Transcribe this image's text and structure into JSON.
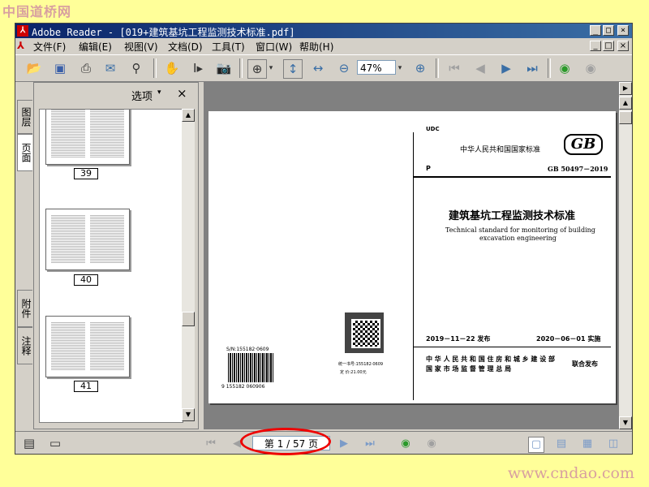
{
  "watermarks": {
    "top": "中国道桥网",
    "bottom": "www.cndao.com"
  },
  "window": {
    "title": "Adobe Reader - [019+建筑基坑工程监测技术标准.pdf]",
    "app_icon": "adobe-reader-icon",
    "controls": [
      "_",
      "□",
      "×"
    ]
  },
  "menu": {
    "items": [
      "文件(F)",
      "编辑(E)",
      "视图(V)",
      "文档(D)",
      "工具(T)",
      "窗口(W)",
      "帮助(H)"
    ],
    "doc_controls": [
      "_",
      "□",
      "×"
    ]
  },
  "toolbar": {
    "zoom_value": "47%",
    "icons": [
      "open-icon",
      "save-icon",
      "print-icon",
      "email-icon",
      "search-icon",
      "hand-icon",
      "select-text-icon",
      "snapshot-icon",
      "zoom-in-tool-icon",
      "fit-page-icon",
      "fit-width-icon",
      "zoom-out-icon",
      "zoom-in-icon",
      "first-page-icon",
      "prev-page-icon",
      "next-page-icon",
      "last-page-icon",
      "back-icon",
      "forward-icon"
    ]
  },
  "side_tabs": [
    "图层",
    "页面",
    "附件",
    "注释"
  ],
  "nav_panel": {
    "options_label": "选项",
    "close_label": "×",
    "thumbnails": [
      {
        "label": "39"
      },
      {
        "label": "40"
      },
      {
        "label": "41"
      }
    ]
  },
  "document_page": {
    "udc": "UDC",
    "national_standard": "中华人民共和国国家标准",
    "gb_logo": "GB",
    "category": "P",
    "code": "GB 50497－2019",
    "title_cn": "建筑基坑工程监测技术标准",
    "title_en_line1": "Technical standard for monitoring of building",
    "title_en_line2": "excavation engineering",
    "publish_date": "2019－11－22 发布",
    "implement_date": "2020－06－01 实施",
    "issuer_line1": "中 华 人 民 共 和 国 住 房 和 城 乡 建 设 部",
    "issuer_line2": "国  家  市  场  监  督  管  理  总  局",
    "joint_release": "联合发布",
    "sn": "S/N:155182·0609",
    "barcode_number": "9 155182 060906",
    "book_number": "统一书号:155182·0609",
    "price": "定    价:21.00元"
  },
  "status": {
    "page_indicator": "第 1 / 57 页"
  }
}
